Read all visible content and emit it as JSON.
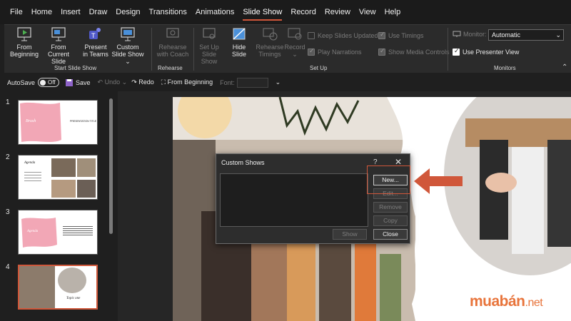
{
  "menu": [
    "File",
    "Home",
    "Insert",
    "Draw",
    "Design",
    "Transitions",
    "Animations",
    "Slide Show",
    "Record",
    "Review",
    "View",
    "Help"
  ],
  "menu_active": "Slide Show",
  "ribbon": {
    "start_group": {
      "label": "Start Slide Show",
      "from_beginning": "From Beginning",
      "from_current": "From Current Slide",
      "present_teams": "Present in Teams",
      "custom_show": "Custom Slide Show"
    },
    "rehearse_group": {
      "label": "Rehearse",
      "rehearse_coach": "Rehearse with Coach"
    },
    "setup_group": {
      "label": "Set Up",
      "setup_show": "Set Up Slide Show",
      "hide_slide": "Hide Slide",
      "rehearse_timings": "Rehearse Timings",
      "record": "Record",
      "keep_updated": "Keep Slides Updated",
      "play_narrations": "Play Narrations",
      "use_timings": "Use Timings",
      "show_media": "Show Media Controls"
    },
    "monitors_group": {
      "label": "Monitors",
      "monitor_label": "Monitor:",
      "monitor_value": "Automatic",
      "presenter_view": "Use Presenter View"
    }
  },
  "qat": {
    "autosave": "AutoSave",
    "autosave_state": "Off",
    "save": "Save",
    "undo": "Undo",
    "redo": "Redo",
    "from_beginning": "From Beginning",
    "font_label": "Font:"
  },
  "thumbnails": [
    {
      "num": "1",
      "title": "Brush",
      "text": "PRESENTATION TITLE"
    },
    {
      "num": "2",
      "title": "Agenda",
      "text": ""
    },
    {
      "num": "3",
      "title": "Agenda",
      "text": ""
    },
    {
      "num": "4",
      "title": "Topic one",
      "text": ""
    }
  ],
  "dialog": {
    "title": "Custom Shows",
    "help": "?",
    "close_x": "✕",
    "new": "New...",
    "edit": "Edit...",
    "remove": "Remove",
    "copy": "Copy",
    "show": "Show",
    "close": "Close"
  },
  "watermark": {
    "brand": "muabán",
    "tld": ".net"
  },
  "colors": {
    "accent": "#d0573a",
    "arrow": "#d0573a",
    "pink": "#f2a7b6",
    "watermark": "#e8743b"
  }
}
